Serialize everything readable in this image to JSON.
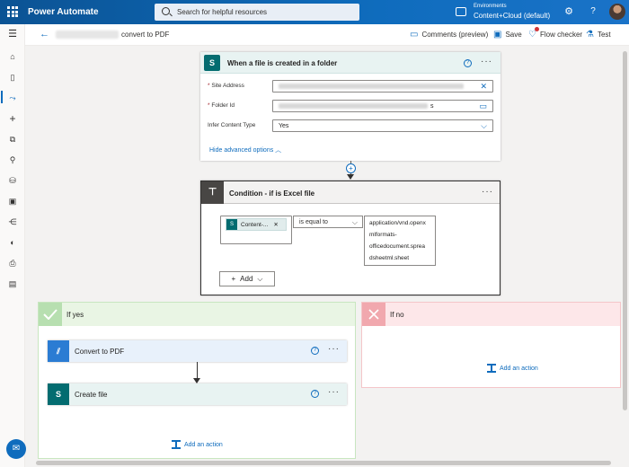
{
  "topbar": {
    "app_title": "Power Automate",
    "search_placeholder": "Search for helpful resources",
    "env_label": "Environments",
    "env_value": "Content+Cloud (default)",
    "help": "?"
  },
  "cmdbar": {
    "flow_title": "convert to PDF",
    "comments": "Comments (preview)",
    "save": "Save",
    "flow_checker": "Flow checker",
    "test": "Test"
  },
  "trigger": {
    "title": "When a file is created in a folder",
    "site_address_label": "Site Address",
    "folder_id_label": "Folder Id",
    "folder_id_suffix": "s",
    "infer_label": "Infer Content Type",
    "infer_value": "Yes",
    "advanced_link": "Hide advanced options"
  },
  "condition": {
    "title": "Condition - if is Excel file",
    "token_label": "Content-...",
    "operator": "is equal to",
    "value_lines": [
      "application/vnd.openx",
      "mlformats-",
      "officedocument.sprea",
      "dsheetml.sheet"
    ],
    "add_label": "Add"
  },
  "branch_yes": {
    "title": "If yes",
    "actions": [
      {
        "title": "Convert to PDF"
      },
      {
        "title": "Create file"
      }
    ],
    "add_action": "Add an action"
  },
  "branch_no": {
    "title": "If no",
    "add_action": "Add an action"
  },
  "colors": {
    "brand": "#0f6cbd",
    "sharepoint": "#036c70",
    "yes_header": "#e9f5e4",
    "yes_accent": "#5db65a",
    "no_header": "#fde7e9",
    "no_accent": "#e85d5d"
  }
}
